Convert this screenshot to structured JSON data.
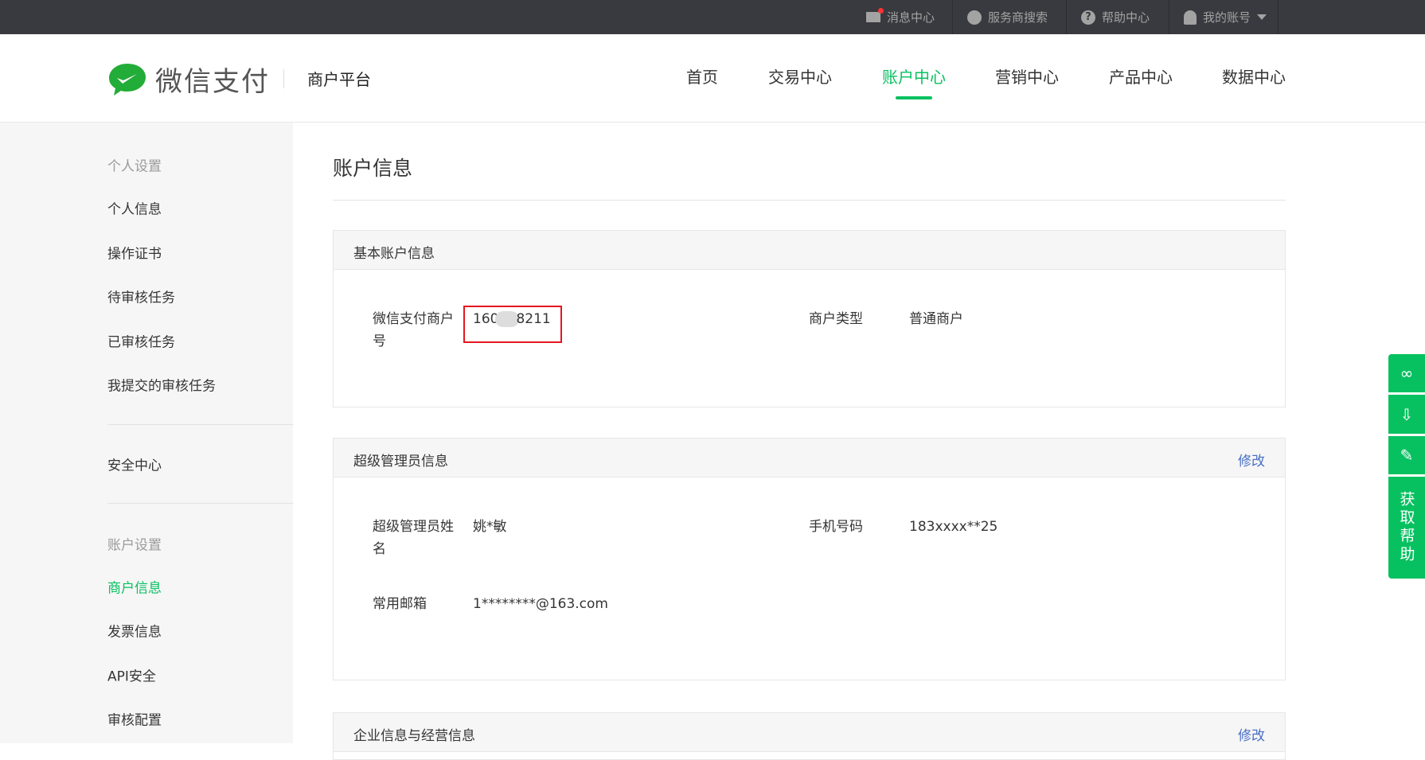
{
  "topbar": {
    "messages": "消息中心",
    "provider_search": "服务商搜索",
    "help": "帮助中心",
    "account": "我的账号"
  },
  "header": {
    "logo_text": "微信支付",
    "platform": "商户平台",
    "nav": [
      "首页",
      "交易中心",
      "账户中心",
      "营销中心",
      "产品中心",
      "数据中心"
    ],
    "active_nav": "账户中心"
  },
  "sidebar": {
    "group1": "个人设置",
    "items1": [
      "个人信息",
      "操作证书",
      "待审核任务",
      "已审核任务",
      "我提交的审核任务"
    ],
    "security": "安全中心",
    "group2": "账户设置",
    "items2": [
      "商户信息",
      "发票信息",
      "API安全",
      "审核配置"
    ]
  },
  "main": {
    "title": "账户信息",
    "basic": {
      "title": "基本账户信息",
      "merchant_id_label": "微信支付商户号",
      "merchant_id_prefix": "160",
      "merchant_id_suffix": "8211",
      "type_label": "商户类型",
      "type_value": "普通商户"
    },
    "admin": {
      "title": "超级管理员信息",
      "edit": "修改",
      "name_label": "超级管理员姓名",
      "name_value": "姚*敏",
      "phone_label": "手机号码",
      "phone_value": "183xxxx**25",
      "email_label": "常用邮箱",
      "email_value": "1********@163.com"
    },
    "company": {
      "title": "企业信息与经营信息",
      "edit": "修改"
    }
  },
  "float": {
    "help": "获取帮助"
  },
  "colors": {
    "brand": "#07c160",
    "topbar": "#393a3f",
    "link": "#4a6fc6",
    "highlight": "#e5161e"
  }
}
